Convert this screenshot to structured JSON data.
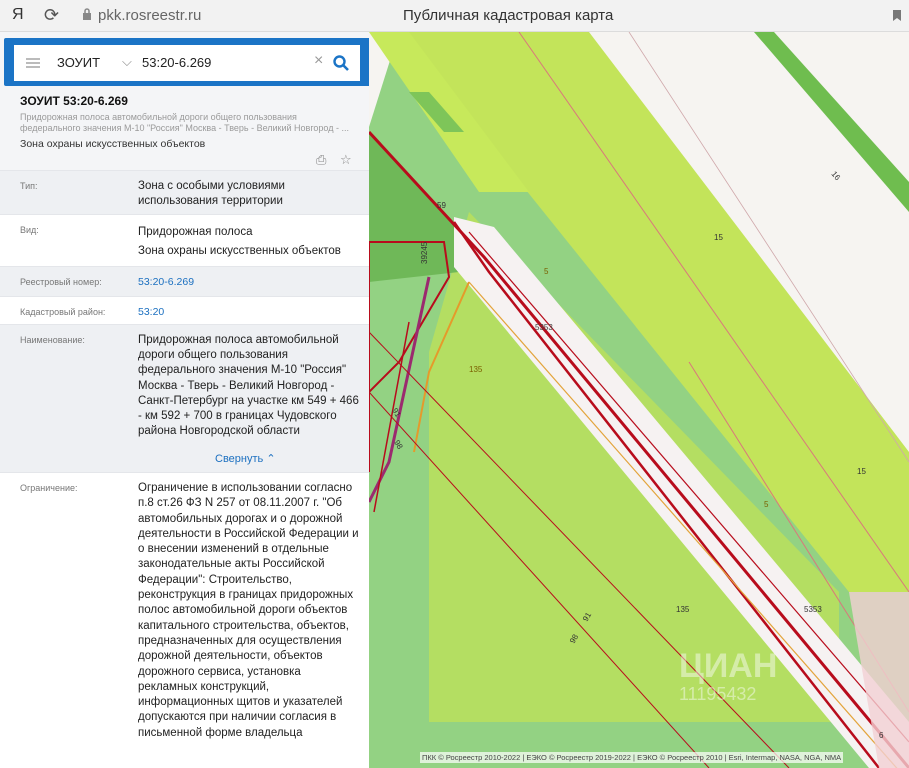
{
  "browser": {
    "logo": "Я",
    "url": "pkk.rosreestr.ru",
    "title": "Публичная кадастровая карта"
  },
  "search": {
    "type": "ЗОУИТ",
    "query": "53:20-6.269"
  },
  "object": {
    "title": "ЗОУИТ 53:20-6.269",
    "subtitle": "Придорожная полоса автомобильной дороги общего пользования федерального значения М-10 \"Россия\" Москва - Тверь - Великий Новгород - ...",
    "zone": "Зона охраны искусственных объектов"
  },
  "fields": [
    {
      "label": "Тип:",
      "value": "Зона с особыми условиями использования территории"
    },
    {
      "label": "Вид:",
      "value": "Придорожная полоса\nЗона охраны искусственных объектов"
    },
    {
      "label": "Реестровый номер:",
      "value": "53:20-6.269"
    },
    {
      "label": "Кадастровый район:",
      "value": "53:20"
    },
    {
      "label": "Наименование:",
      "value": "Придорожная полоса автомобильной дороги общего пользования федерального значения М-10 \"Россия\" Москва - Тверь - Великий Новгород - Санкт-Петербург на участке км 549 + 466 - км 592 + 700 в границах Чудовского района Новгородской области"
    },
    {
      "label": "Ограничение:",
      "value": "Ограничение в использовании согласно п.8 ст.26 ФЗ N 257 от 08.11.2007 г. \"Об автомобильных дорогах и о дорожной деятельности в Российской Федерации и о внесении изменений в отдельные законодательные акты Российской Федерации\": Строительство, реконструкция в границах придорожных полос автомобильной дороги объектов капитального строительства, объектов, предназначенных для осуществления дорожной деятельности, объектов дорожного сервиса, установка рекламных конструкций, информационных щитов и указателей допускаются при наличии согласия в письменной форме владельца"
    }
  ],
  "collapse_label": "Свернуть",
  "map": {
    "labels": [
      "15",
      "16",
      "5",
      "5353",
      "135",
      "15",
      "5",
      "135",
      "5353",
      "59",
      "39245",
      "91",
      "98",
      "91",
      "98",
      "6"
    ],
    "attribution": "ПКК © Росреестр 2010-2022 | ЕЭКО © Росреестр 2019-2022 | ЕЭКО © Росреестр 2010 | Esri, Intermap, NASA, NGA, NMA",
    "watermark": "ЦИАН",
    "watermark_id": "11195432"
  },
  "colors": {
    "accent": "#1b74c6",
    "light_green": "#b7e05b",
    "mid_green": "#8fcf6f",
    "road_red": "#b80c1c"
  }
}
